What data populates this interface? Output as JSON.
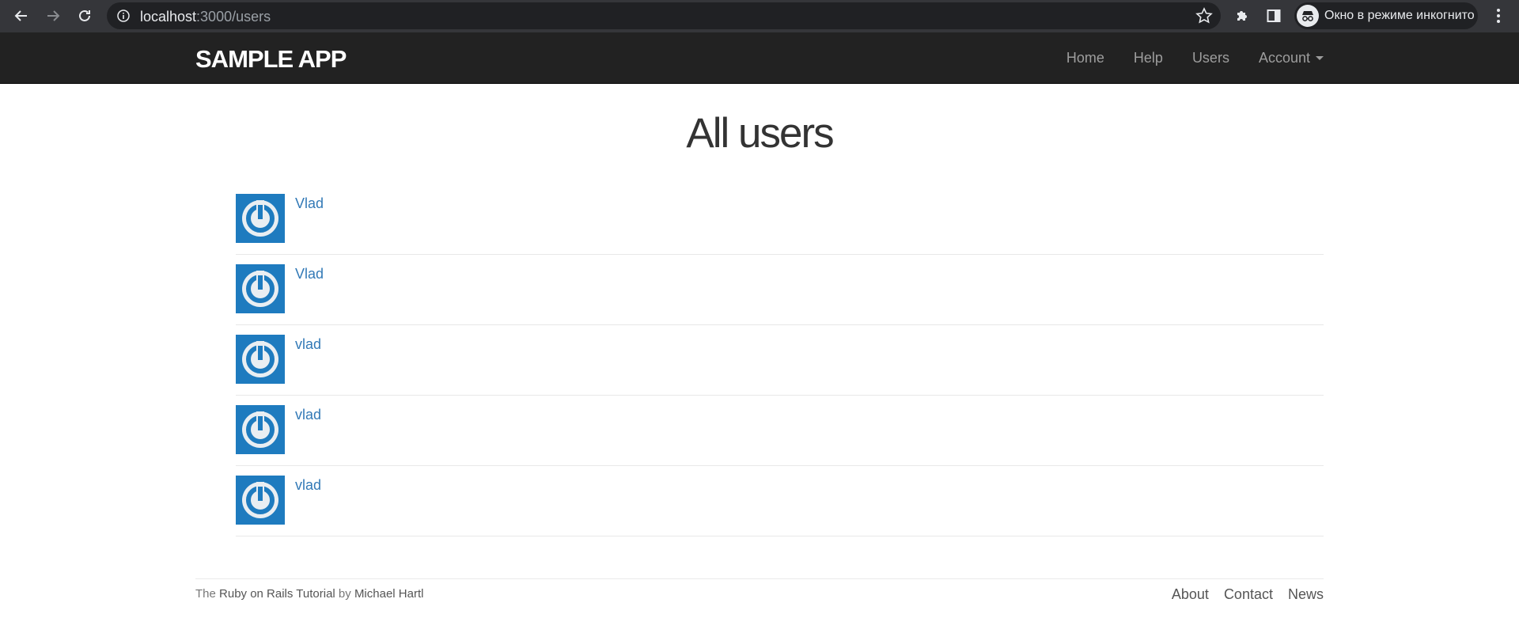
{
  "browser": {
    "url_host": "localhost",
    "url_path": ":3000/users",
    "incognito_label": "Окно в режиме инкогнито",
    "icons": [
      "back-icon",
      "forward-icon",
      "reload-icon",
      "info-icon",
      "star-icon",
      "extensions-icon",
      "side-panel-icon",
      "incognito-icon",
      "menu-dots-icon"
    ]
  },
  "navbar": {
    "brand": "SAMPLE APP",
    "links": [
      {
        "label": "Home"
      },
      {
        "label": "Help"
      },
      {
        "label": "Users"
      },
      {
        "label": "Account"
      }
    ]
  },
  "main": {
    "title": "All users",
    "users": [
      {
        "name": "Vlad"
      },
      {
        "name": "Vlad"
      },
      {
        "name": "vlad"
      },
      {
        "name": "vlad"
      },
      {
        "name": "vlad"
      }
    ]
  },
  "footer": {
    "prefix": "The ",
    "tutorial_link": "Ruby on Rails Tutorial",
    "middle": " by ",
    "author_link": "Michael Hartl",
    "links": [
      {
        "label": "About"
      },
      {
        "label": "Contact"
      },
      {
        "label": "News"
      }
    ]
  },
  "colors": {
    "navbar_bg": "#222222",
    "link": "#337ab7",
    "gravatar_bg": "#1e7bbf"
  }
}
